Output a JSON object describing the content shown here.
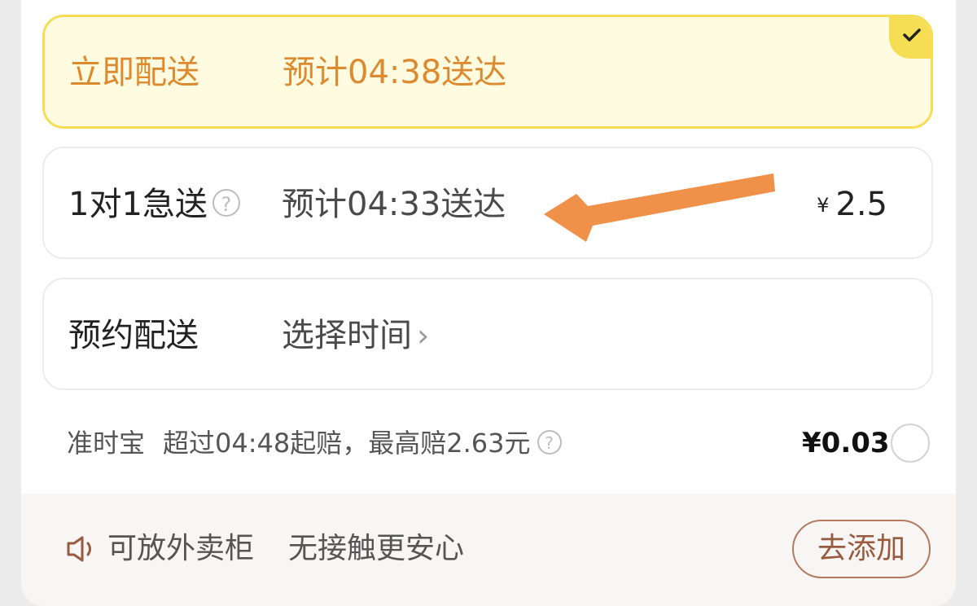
{
  "colors": {
    "accent_yellow": "#f6de54",
    "express_bg": "#fffbe0",
    "orange_text": "#dd8a2e",
    "arrow": "#f0914a",
    "add_button_border": "#b57a5e"
  },
  "options": {
    "express": {
      "label": "立即配送",
      "eta": "预计04:38送达",
      "selected": true,
      "check_icon": "checkmark-icon"
    },
    "urgent": {
      "label": "1对1急送",
      "help_icon": "?",
      "eta": "预计04:33送达",
      "currency": "¥",
      "price": "2.5"
    },
    "schedule": {
      "label": "预约配送",
      "action": "选择时间",
      "chevron": "›"
    }
  },
  "insurance": {
    "name": "准时宝",
    "desc": "超过04:48起赔，最高赔2.63元",
    "help_icon": "?",
    "price": "¥0.03",
    "selected": false
  },
  "footer": {
    "icon": "speaker-icon",
    "text": "可放外卖柜",
    "subtext": "无接触更安心",
    "button": "去添加"
  }
}
